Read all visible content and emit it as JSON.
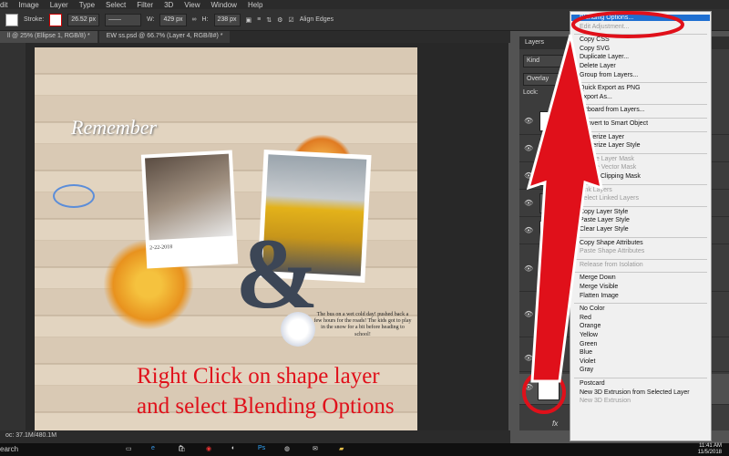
{
  "menubar": {
    "items": [
      "dit",
      "Image",
      "Layer",
      "Type",
      "Select",
      "Filter",
      "3D",
      "View",
      "Window",
      "Help"
    ]
  },
  "options": {
    "stroke_label": "Stroke:",
    "stroke_size": "26.52 px",
    "w_label": "W:",
    "w_value": "429 px",
    "h_label": "H:",
    "h_value": "238 px",
    "align_label": "Align Edges"
  },
  "tabs": [
    "ll @ 25% (Ellipse 1, RGB/8) *",
    "EW ss.psd @ 66.7% (Layer 4, RGB/8#) *"
  ],
  "status": {
    "doc": "oc: 37.1M/480.1M"
  },
  "canvas": {
    "title": "Remember",
    "date": "2-22-2018",
    "journal": "The bus on a wet cold day! pushed back a few hours for the roads! The kids got to play in the snow for a bit before heading to school!",
    "sign": "SCHOOL BUS"
  },
  "instruction": {
    "line1": "Right Click on shape layer",
    "line2": "and select Blending Options"
  },
  "layers": {
    "panel_title": "Layers",
    "kind": "Kind",
    "blend": "Overlay",
    "lock": "Lock:",
    "fx": "fx"
  },
  "context_menu": [
    {
      "label": "Blending Options...",
      "state": "highlight"
    },
    {
      "label": "Edit Adjustment...",
      "state": "disabled"
    },
    {
      "sep": true
    },
    {
      "label": "Copy CSS"
    },
    {
      "label": "Copy SVG"
    },
    {
      "label": "Duplicate Layer..."
    },
    {
      "label": "Delete Layer"
    },
    {
      "label": "Group from Layers..."
    },
    {
      "sep": true
    },
    {
      "label": "Quick Export as PNG"
    },
    {
      "label": "Export As..."
    },
    {
      "sep": true
    },
    {
      "label": "Artboard from Layers..."
    },
    {
      "sep": true
    },
    {
      "label": "Convert to Smart Object"
    },
    {
      "sep": true
    },
    {
      "label": "Rasterize Layer"
    },
    {
      "label": "Rasterize Layer Style"
    },
    {
      "sep": true
    },
    {
      "label": "Enable Layer Mask",
      "state": "disabled"
    },
    {
      "label": "Enable Vector Mask",
      "state": "disabled"
    },
    {
      "label": "Create Clipping Mask"
    },
    {
      "sep": true
    },
    {
      "label": "Link Layers",
      "state": "disabled"
    },
    {
      "label": "Select Linked Layers",
      "state": "disabled"
    },
    {
      "sep": true
    },
    {
      "label": "Copy Layer Style"
    },
    {
      "label": "Paste Layer Style"
    },
    {
      "label": "Clear Layer Style"
    },
    {
      "sep": true
    },
    {
      "label": "Copy Shape Attributes"
    },
    {
      "label": "Paste Shape Attributes",
      "state": "disabled"
    },
    {
      "sep": true
    },
    {
      "label": "Release from Isolation",
      "state": "disabled"
    },
    {
      "sep": true
    },
    {
      "label": "Merge Down"
    },
    {
      "label": "Merge Visible"
    },
    {
      "label": "Flatten Image"
    },
    {
      "sep": true
    },
    {
      "label": "No Color"
    },
    {
      "label": "Red"
    },
    {
      "label": "Orange"
    },
    {
      "label": "Yellow"
    },
    {
      "label": "Green"
    },
    {
      "label": "Blue"
    },
    {
      "label": "Violet"
    },
    {
      "label": "Gray"
    },
    {
      "sep": true
    },
    {
      "label": "Postcard"
    },
    {
      "label": "New 3D Extrusion from Selected Layer"
    },
    {
      "label": "New 3D Extrusion",
      "state": "disabled"
    }
  ],
  "taskbar": {
    "search": "earch",
    "time": "11:41 AM",
    "date": "11/5/2018"
  },
  "colors": {
    "highlight": "#1f6fd1",
    "instruction": "#e0101a",
    "arrow": "#e0101a"
  }
}
